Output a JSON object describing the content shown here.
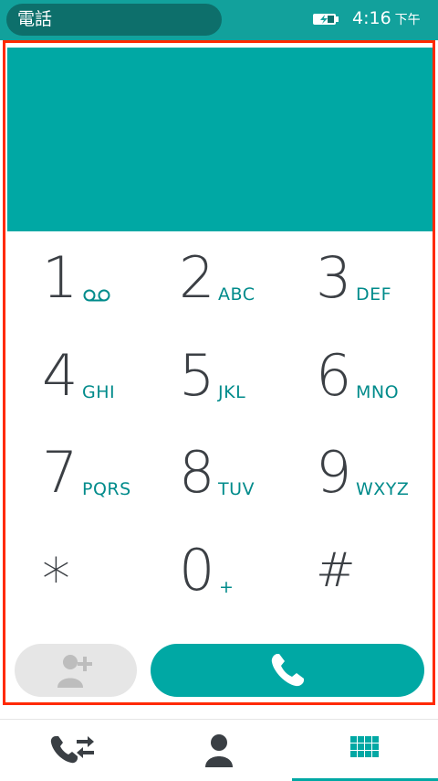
{
  "status_bar": {
    "app_title": "電話",
    "time": "4:16",
    "ampm": "下午",
    "battery_icon": "battery-charging-icon"
  },
  "display": {
    "number": ""
  },
  "keypad": {
    "keys": [
      {
        "digit": "1",
        "letters": "",
        "icon": "voicemail-icon"
      },
      {
        "digit": "2",
        "letters": "ABC"
      },
      {
        "digit": "3",
        "letters": "DEF"
      },
      {
        "digit": "4",
        "letters": "GHI"
      },
      {
        "digit": "5",
        "letters": "JKL"
      },
      {
        "digit": "6",
        "letters": "MNO"
      },
      {
        "digit": "7",
        "letters": "PQRS"
      },
      {
        "digit": "8",
        "letters": "TUV"
      },
      {
        "digit": "9",
        "letters": "WXYZ"
      },
      {
        "digit": "*",
        "letters": ""
      },
      {
        "digit": "0",
        "letters": "+"
      },
      {
        "digit": "#",
        "letters": ""
      }
    ]
  },
  "actions": {
    "add_contact_icon": "add-contact-icon",
    "call_icon": "phone-icon"
  },
  "tabs": [
    {
      "name": "call-log",
      "icon": "call-log-icon",
      "selected": false
    },
    {
      "name": "contacts",
      "icon": "contact-person-icon",
      "selected": false
    },
    {
      "name": "keypad",
      "icon": "dialpad-grid-icon",
      "selected": true
    }
  ],
  "colors": {
    "accent": "#00a8a4",
    "status_bar": "#12a19c",
    "highlight_frame": "#ff2a00",
    "digit_text": "#3b3f44",
    "letter_text": "#008b8b"
  }
}
